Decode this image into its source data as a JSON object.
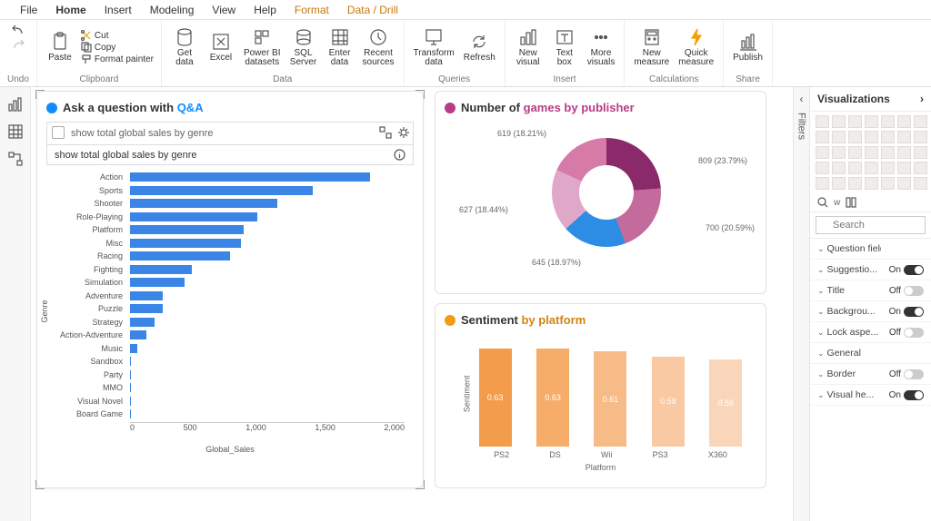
{
  "menubar": [
    "File",
    "Home",
    "Insert",
    "Modeling",
    "View",
    "Help",
    "Format",
    "Data / Drill"
  ],
  "menubar_active": "Home",
  "ribbon": {
    "undo": {
      "label": "Undo"
    },
    "clipboard": {
      "paste": "Paste",
      "cut": "Cut",
      "copy": "Copy",
      "format_painter": "Format painter",
      "group": "Clipboard"
    },
    "data": {
      "get_data": "Get\ndata",
      "excel": "Excel",
      "pbi_ds": "Power BI\ndatasets",
      "sql": "SQL\nServer",
      "enter": "Enter\ndata",
      "recent": "Recent\nsources",
      "group": "Data"
    },
    "queries": {
      "transform": "Transform\ndata",
      "refresh": "Refresh",
      "group": "Queries"
    },
    "insert": {
      "new_visual": "New\nvisual",
      "text_box": "Text\nbox",
      "more": "More\nvisuals",
      "group": "Insert"
    },
    "calc": {
      "new_measure": "New\nmeasure",
      "quick": "Quick\nmeasure",
      "group": "Calculations"
    },
    "share": {
      "publish": "Publish",
      "group": "Share"
    }
  },
  "qa": {
    "title_prefix": "Ask a question with ",
    "title_em": "Q&A",
    "input": "show total global sales by genre",
    "suggestion": "show total global sales by genre",
    "y_title": "Genre",
    "x_title": "Global_Sales",
    "x_ticks": [
      "0",
      "500",
      "1,000",
      "1,500",
      "2,000"
    ]
  },
  "publisher": {
    "title_prefix": "Number of ",
    "title_em": "games by publisher",
    "labels": {
      "a": "809 (23.79%)",
      "b": "700 (20.59%)",
      "c": "645 (18.97%)",
      "d": "627 (18.44%)",
      "e": "619 (18.21%)"
    }
  },
  "sentiment": {
    "title_prefix": "Sentiment ",
    "title_em": "by platform",
    "x_title": "Platform",
    "y_title": "Sentiment"
  },
  "filters_label": "Filters",
  "vizpane": {
    "title": "Visualizations",
    "search": "Search",
    "tools_w": "w",
    "props": [
      {
        "label": "Question field",
        "toggle": null
      },
      {
        "label": "Suggestio...",
        "toggle": "On"
      },
      {
        "label": "Title",
        "toggle": "Off"
      },
      {
        "label": "Backgrou...",
        "toggle": "On"
      },
      {
        "label": "Lock aspe...",
        "toggle": "Off"
      },
      {
        "label": "General",
        "toggle": null
      },
      {
        "label": "Border",
        "toggle": "Off"
      },
      {
        "label": "Visual he...",
        "toggle": "On"
      }
    ]
  },
  "chart_data": [
    {
      "id": "global_sales_by_genre",
      "type": "bar",
      "orientation": "horizontal",
      "xlabel": "Global_Sales",
      "ylabel": "Genre",
      "xlim": [
        0,
        2000
      ],
      "categories": [
        "Action",
        "Sports",
        "Shooter",
        "Role-Playing",
        "Platform",
        "Misc",
        "Racing",
        "Fighting",
        "Simulation",
        "Adventure",
        "Puzzle",
        "Strategy",
        "Action-Adventure",
        "Music",
        "Sandbox",
        "Party",
        "MMO",
        "Visual Novel",
        "Board Game"
      ],
      "values": [
        1750,
        1330,
        1070,
        930,
        830,
        810,
        730,
        450,
        400,
        240,
        240,
        180,
        120,
        50,
        5,
        5,
        5,
        5,
        5
      ]
    },
    {
      "id": "games_by_publisher",
      "type": "pie",
      "title": "Number of games by publisher",
      "series": [
        {
          "value": 809,
          "pct": 23.79
        },
        {
          "value": 700,
          "pct": 20.59
        },
        {
          "value": 645,
          "pct": 18.97
        },
        {
          "value": 627,
          "pct": 18.44
        },
        {
          "value": 619,
          "pct": 18.21
        }
      ]
    },
    {
      "id": "sentiment_by_platform",
      "type": "bar",
      "xlabel": "Platform",
      "ylabel": "Sentiment",
      "ylim": [
        0,
        0.7
      ],
      "categories": [
        "PS2",
        "DS",
        "Wii",
        "PS3",
        "X360"
      ],
      "values": [
        0.63,
        0.63,
        0.61,
        0.58,
        0.56
      ],
      "colors": [
        "#f29c4c",
        "#f6ad6a",
        "#f7bb87",
        "#f8c9a3",
        "#f9d6ba"
      ]
    }
  ]
}
